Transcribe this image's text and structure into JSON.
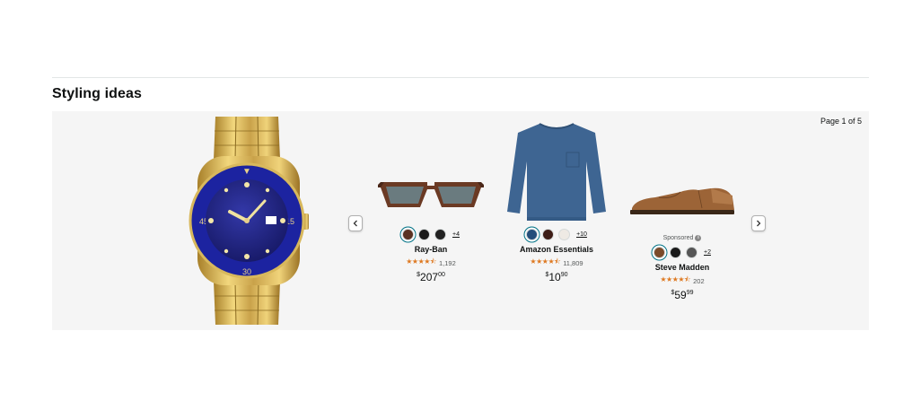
{
  "section": {
    "title": "Styling ideas",
    "page_indicator": "Page 1 of 5"
  },
  "hero": {
    "icon": "gold-blue-watch-image"
  },
  "products": [
    {
      "brand": "Ray-Ban",
      "rating_count": "1,192",
      "rating_stars": "★★★★⯪",
      "price_symbol": "$",
      "price_whole": "207",
      "price_fraction": "00",
      "more": "+4",
      "sponsored": "",
      "swatches": [
        "#5a3222",
        "#1a1a1a",
        "#222222"
      ]
    },
    {
      "brand": "Amazon Essentials",
      "rating_count": "11,809",
      "rating_stars": "★★★★⯪",
      "price_symbol": "$",
      "price_whole": "10",
      "price_fraction": "90",
      "more": "+10",
      "sponsored": "",
      "swatches": [
        "#254e7a",
        "#3e1d17",
        "#eeeae4"
      ]
    },
    {
      "brand": "Steve Madden",
      "rating_count": "202",
      "rating_stars": "★★★★⯪",
      "price_symbol": "$",
      "price_whole": "59",
      "price_fraction": "99",
      "more": "+2",
      "sponsored": "Sponsored",
      "swatches": [
        "#7a4a2a",
        "#1a1a1a",
        "#555555"
      ]
    }
  ],
  "colors": {
    "accent": "#007185",
    "star": "#de7921",
    "panel": "#f5f5f5"
  }
}
